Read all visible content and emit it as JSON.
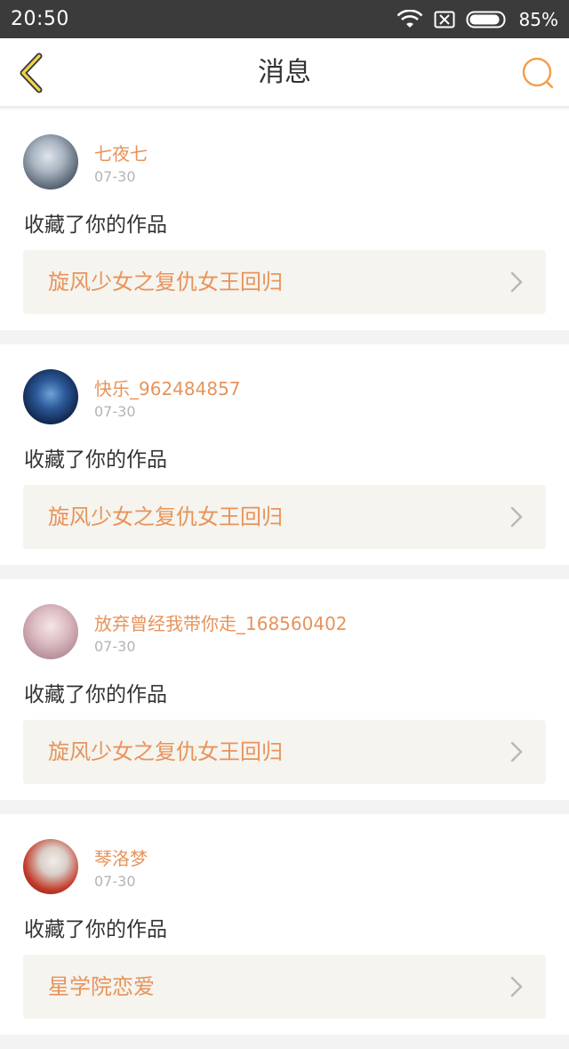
{
  "status": {
    "time": "20:50",
    "battery": "85%"
  },
  "nav": {
    "title": "消息"
  },
  "messages": [
    {
      "user": "七夜七",
      "date": "07-30",
      "action": "收藏了你的作品",
      "work": "旋风少女之复仇女王回归",
      "avatar_color": "#8a9aa8"
    },
    {
      "user": "快乐_962484857",
      "date": "07-30",
      "action": "收藏了你的作品",
      "work": "旋风少女之复仇女王回归",
      "avatar_color": "#1e3a6a"
    },
    {
      "user": "放弃曾经我带你走_168560402",
      "date": "07-30",
      "action": "收藏了你的作品",
      "work": "旋风少女之复仇女王回归",
      "avatar_color": "#d9b8c0"
    },
    {
      "user": "琴洛梦",
      "date": "07-30",
      "action": "收藏了你的作品",
      "work": "星学院恋爱",
      "avatar_color": "#c23a2a"
    }
  ]
}
